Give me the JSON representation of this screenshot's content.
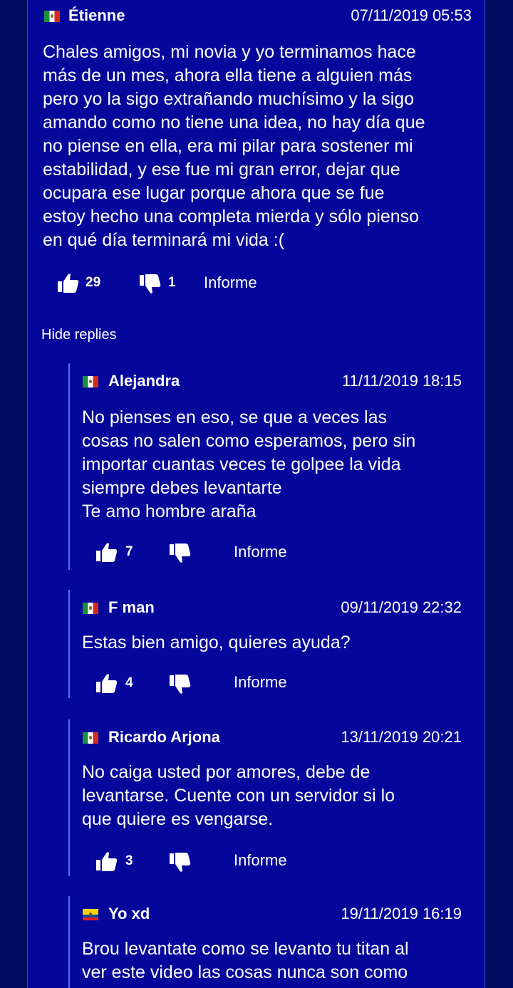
{
  "comments": [
    {
      "country": "mexico-flag-icon",
      "author": "Étienne",
      "date": "07/11/2019 05:53",
      "text": "Chales amigos, mi novia y yo terminamos hace\nmás de un mes, ahora ella tiene a alguien más\npero yo la sigo extrañando muchísimo y la sigo\namando como no tiene una idea, no hay día que\nno piense en ella, era mi pilar para sostener mi\nestabilidad, y ese fue mi gran error, dejar que\nocupara ese lugar porque ahora que se fue\nestoy hecho una completa mierda y sólo pienso\nen qué día terminará mi vida :(",
      "likes": "29",
      "dislikes": "1",
      "report": "Informe"
    }
  ],
  "hide_replies": "Hide replies",
  "replies": [
    {
      "country": "mexico-flag-icon",
      "author": "Alejandra",
      "date": "11/11/2019 18:15",
      "text": "No pienses en eso, se que a veces las\ncosas no salen como esperamos, pero sin\nimportar cuantas veces te golpee la vida\nsiempre debes levantarte\nTe amo hombre araña",
      "likes": "7",
      "dislikes": "",
      "report": "Informe"
    },
    {
      "country": "mexico-flag-icon",
      "author": "F man",
      "date": "09/11/2019 22:32",
      "text": "Estas bien amigo, quieres ayuda?",
      "likes": "4",
      "dislikes": "",
      "report": "Informe"
    },
    {
      "country": "mexico-flag-icon",
      "author": "Ricardo Arjona",
      "date": "13/11/2019 20:21",
      "text": "No caiga usted por amores, debe de\nlevantarse. Cuente con un servidor si lo\nque quiere es vengarse.",
      "likes": "3",
      "dislikes": "",
      "report": "Informe"
    },
    {
      "country": "ecuador-flag-icon",
      "author": "Yo xd",
      "date": "19/11/2019 16:19",
      "text": "Brou levantate como se levanto tu titan al\nver este video las cosas nunca son como",
      "likes": "",
      "dislikes": "",
      "report": ""
    }
  ],
  "colors": {
    "background": "#000c5e",
    "panel": "#05079a",
    "reply_bar": "#5a6bf0",
    "text": "#ffffff"
  }
}
